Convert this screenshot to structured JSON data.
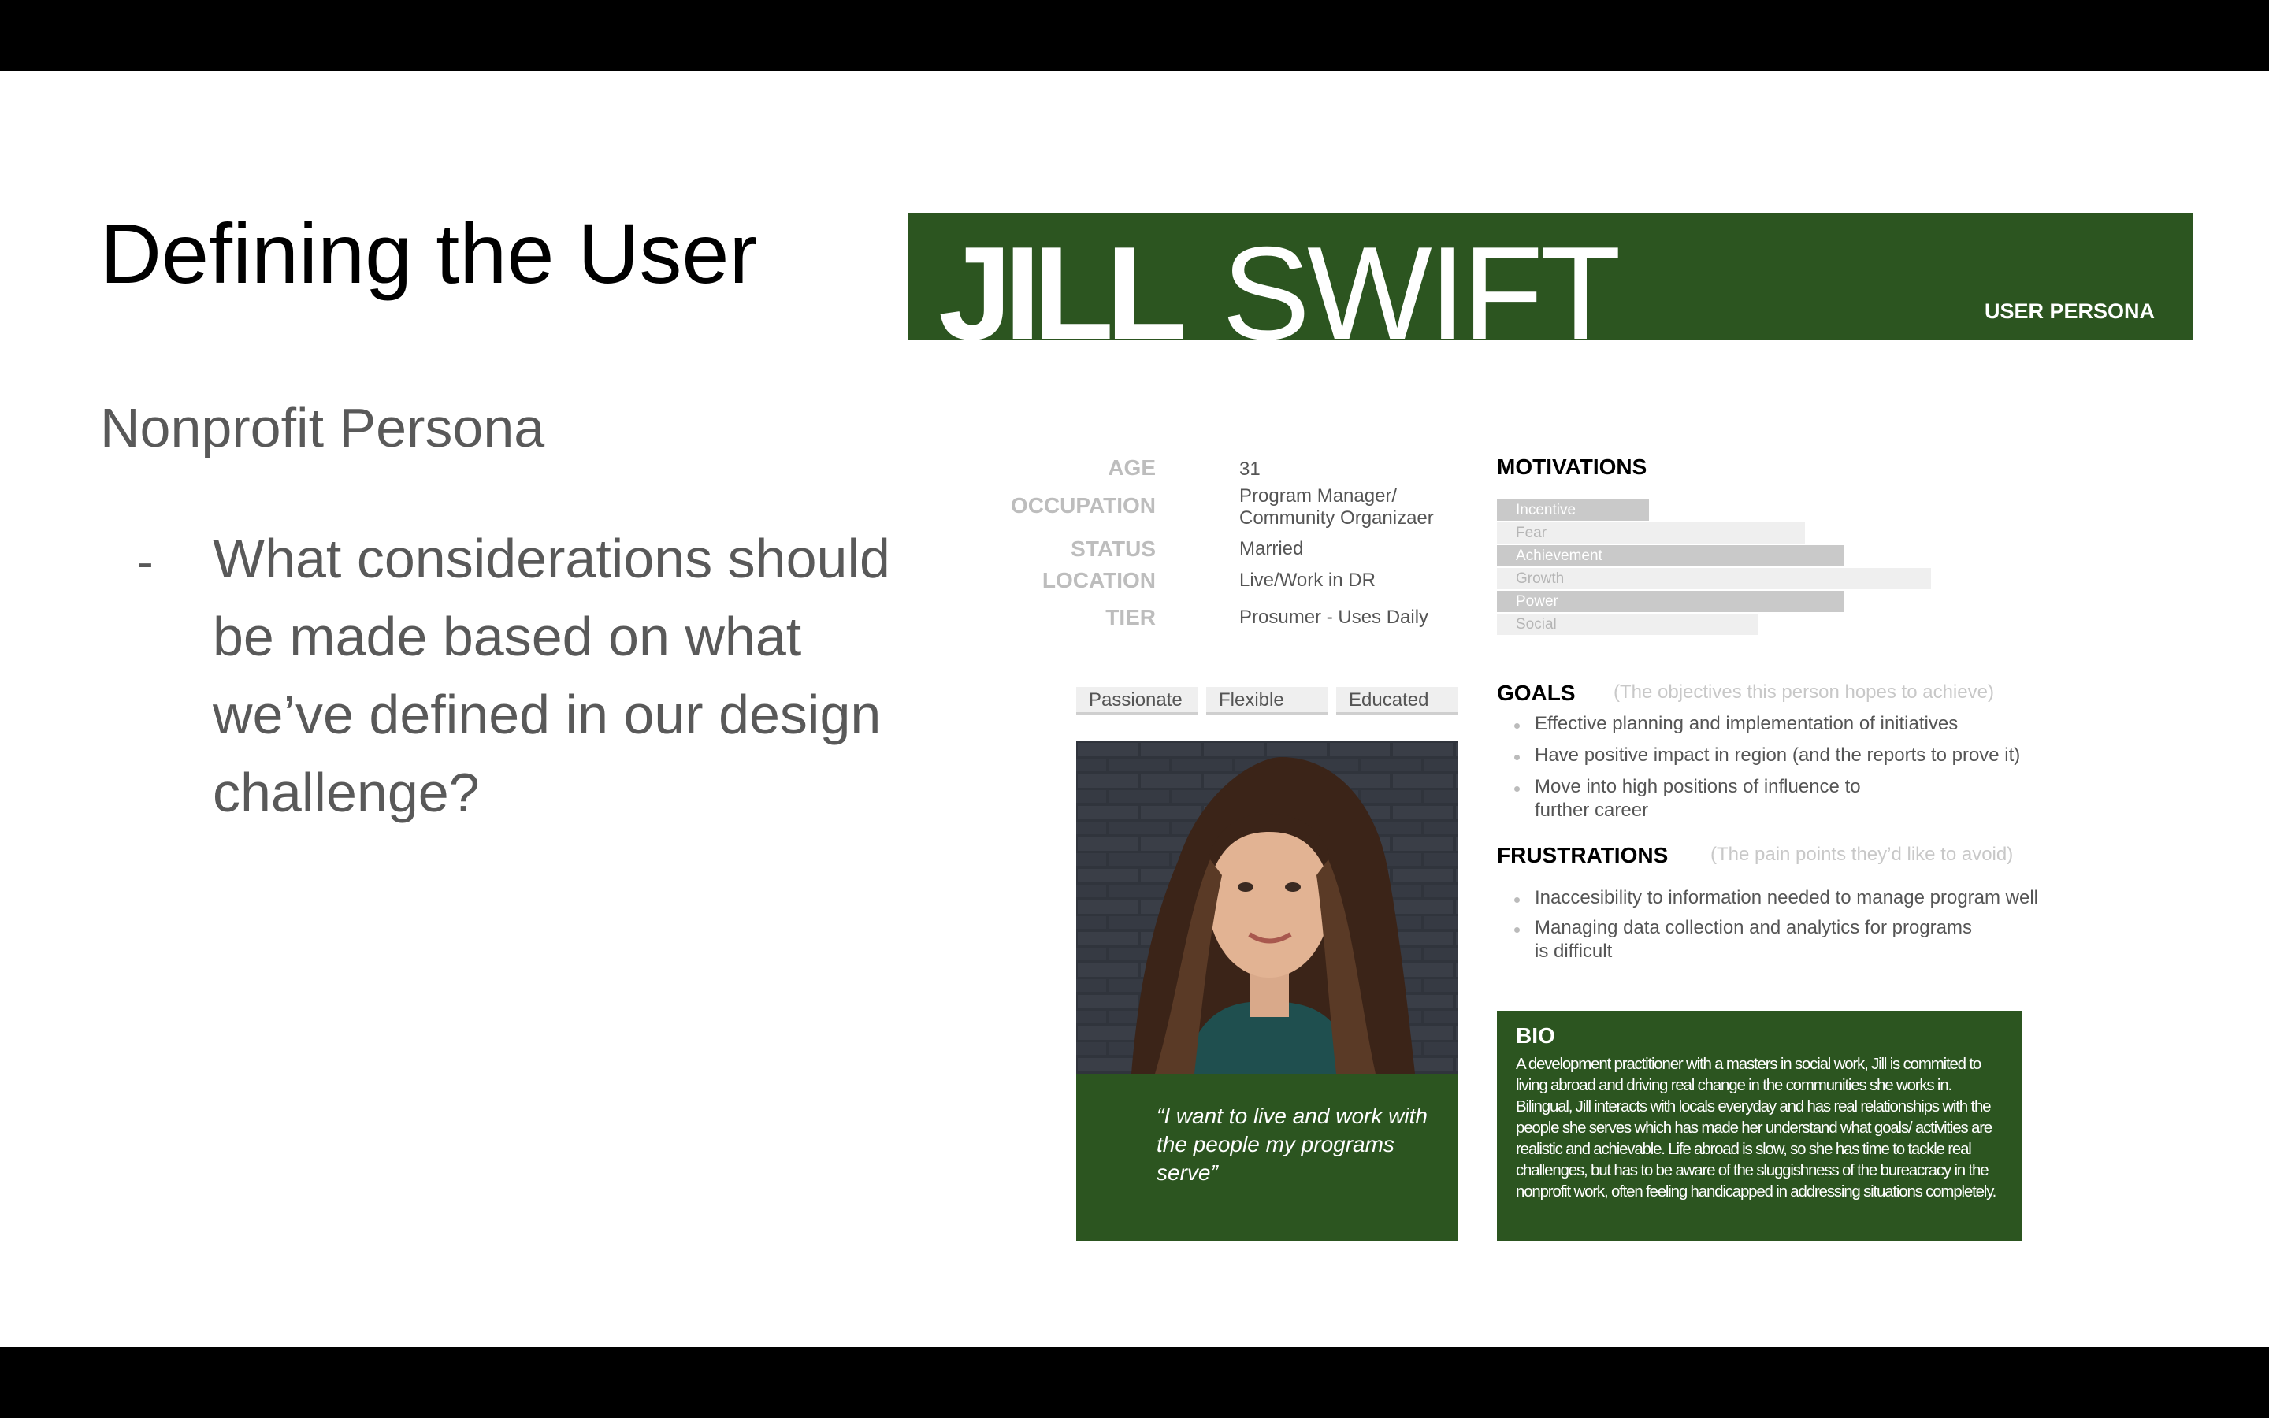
{
  "slide": {
    "title": "Defining the User",
    "subtitle": "Nonprofit Persona",
    "bullet_marker": "-",
    "bullet_text": "What considerations should be made based on what we’ve defined in our design challenge?"
  },
  "persona": {
    "first_name": "JILL",
    "last_name": "SWIFT",
    "label": "USER PERSONA",
    "info": [
      {
        "label": "AGE",
        "value": "31"
      },
      {
        "label": "OCCUPATION",
        "value": "Program Manager/",
        "value2": "Community Organizaer"
      },
      {
        "label": "STATUS",
        "value": "Married"
      },
      {
        "label": "LOCATION",
        "value": "Live/Work in DR"
      },
      {
        "label": "TIER",
        "value": "Prosumer - Uses Daily"
      }
    ],
    "traits": [
      "Passionate",
      "Flexible",
      "Educated"
    ],
    "quote": "“I want to live and work with the people my programs serve”",
    "motivations": {
      "title": "MOTIVATIONS",
      "items": [
        {
          "label": "Incentive",
          "level": 0.35
        },
        {
          "label": "Fear",
          "level": 0.71
        },
        {
          "label": "Achievement",
          "level": 0.8
        },
        {
          "label": "Growth",
          "level": 1.0
        },
        {
          "label": "Power",
          "level": 0.8
        },
        {
          "label": "Social",
          "level": 0.6
        }
      ]
    },
    "goals": {
      "title": "GOALS",
      "hint": "(The objectives this person hopes to achieve)",
      "items": [
        "Effective planning and implementation of initiatives",
        "Have positive impact in region (and the reports to prove it)",
        "Move into high positions of influence to further career"
      ]
    },
    "frustrations": {
      "title": "FRUSTRATIONS",
      "hint": "(The pain points they’d like to avoid)",
      "items": [
        "Inaccesibility to information needed to manage program well",
        "Managing data collection and analytics for programs is difficult"
      ]
    },
    "bio": {
      "title": "BIO",
      "text": "A development practitioner with a masters in social work, Jill is commited to living abroad and driving real change in the communities she works in. Bilingual, Jill interacts with locals everyday and has real relationships with the people she serves which has made her understand what goals/ activities are realistic and achievable. Life abroad is slow, so she has time to tackle real challenges, but has to be aware of the sluggishness of the bureacracy in the nonprofit work, often feeling handicapped in addressing situations completely."
    }
  }
}
